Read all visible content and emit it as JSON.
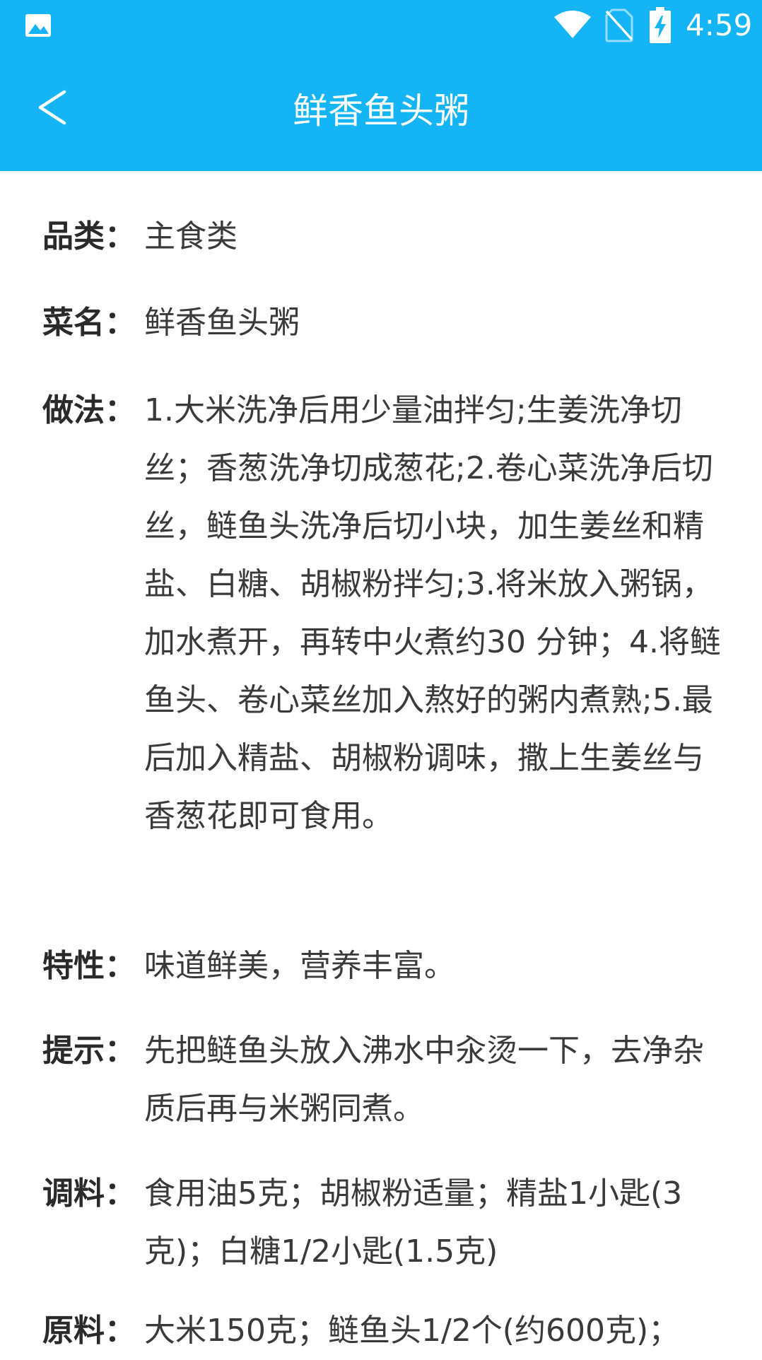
{
  "status_bar": {
    "time": "4:59",
    "icons": [
      "gallery-icon",
      "wifi-icon",
      "no-sim-icon",
      "battery-charging-icon"
    ]
  },
  "header": {
    "title": "鲜香鱼头粥",
    "back_icon": "chevron-left-icon",
    "background_color": "#14b4f5"
  },
  "recipe": {
    "category": {
      "label": "品类：",
      "value": "主食类"
    },
    "name": {
      "label": "菜名：",
      "value": "鲜香鱼头粥"
    },
    "method": {
      "label": "做法：",
      "value": "1.大米洗净后用少量油拌匀;生姜洗净切丝；香葱洗净切成葱花;2.卷心菜洗净后切丝，鲢鱼头洗净后切小块，加生姜丝和精盐、白糖、胡椒粉拌匀;3.将米放入粥锅，加水煮开，再转中火煮约30 分钟；4.将鲢鱼头、卷心菜丝加入熬好的粥内煮熟;5.最后加入精盐、胡椒粉调味，撒上生姜丝与香葱花即可食用。"
    },
    "feature": {
      "label": "特性：",
      "value": "味道鲜美，营养丰富。"
    },
    "tip": {
      "label": "提示：",
      "value": "先把鲢鱼头放入沸水中汆烫一下，去净杂质后再与米粥同煮。"
    },
    "seasoning": {
      "label": "调料：",
      "value": "食用油5克；胡椒粉适量；精盐1小匙(3克)；白糖1/2小匙(1.5克)"
    },
    "ingredients": {
      "label": "原料：",
      "value": "大米150克；鲢鱼头1/2个(约600克)；"
    }
  }
}
